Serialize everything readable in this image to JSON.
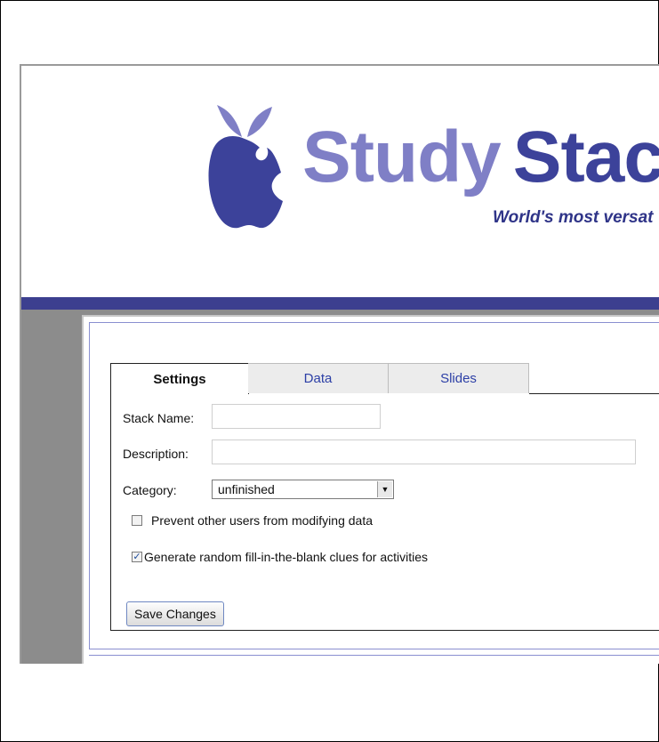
{
  "brand": {
    "word1": "Study",
    "word2": "Stack",
    "tagline": "World's most versat"
  },
  "tabs": [
    {
      "label": "Settings",
      "active": true
    },
    {
      "label": "Data",
      "active": false
    },
    {
      "label": "Slides",
      "active": false
    }
  ],
  "form": {
    "stack_name_label": "Stack Name:",
    "stack_name_value": "",
    "description_label": "Description:",
    "description_value": "",
    "category_label": "Category:",
    "category_value": "unfinished",
    "prevent_label": "Prevent other users from modifying data",
    "prevent_checked": false,
    "generate_label": "Generate random fill-in-the-blank clues for activities",
    "generate_checked": true,
    "save_label": "Save Changes"
  },
  "colors": {
    "brand_light": "#7f7fc6",
    "brand_dark": "#3c429a",
    "header_bar": "#3c3f8f",
    "tab_link": "#2c3fa6"
  },
  "icons": {
    "logo": "apple-logo-icon",
    "dropdown": "chevron-down-icon",
    "checkbox_checked": "checkmark-icon"
  }
}
